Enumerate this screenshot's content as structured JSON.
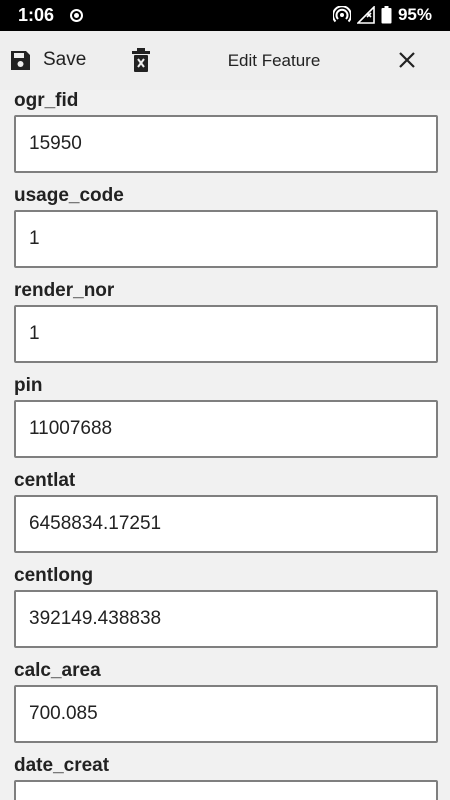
{
  "status_bar": {
    "time": "1:06",
    "battery": "95%"
  },
  "toolbar": {
    "save_label": "Save",
    "title": "Edit Feature"
  },
  "fields": [
    {
      "label": "ogr_fid",
      "value": "15950"
    },
    {
      "label": "usage_code",
      "value": "1"
    },
    {
      "label": "render_nor",
      "value": "1"
    },
    {
      "label": "pin",
      "value": "11007688"
    },
    {
      "label": "centlat",
      "value": "6458834.17251"
    },
    {
      "label": "centlong",
      "value": "392149.438838"
    },
    {
      "label": "calc_area",
      "value": "700.085"
    },
    {
      "label": "date_creat",
      "value": ""
    }
  ],
  "colors": {
    "background": "#f1f1f1",
    "input_border": "#7f7f7f"
  }
}
